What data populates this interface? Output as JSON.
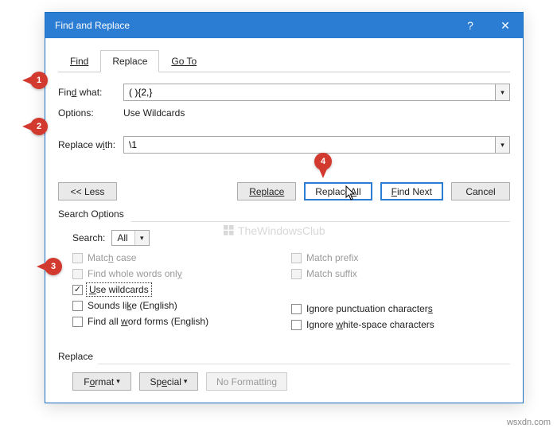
{
  "dialog": {
    "title": "Find and Replace",
    "help": "?",
    "close": "✕"
  },
  "tabs": {
    "find": "Find",
    "replace": "Replace",
    "goto": "Go To"
  },
  "find": {
    "label_pre": "Fin",
    "label_ul": "d",
    "label_post": " what:",
    "value": "( ){2,}",
    "options_label": "Options:",
    "options_value": "Use Wildcards"
  },
  "replace": {
    "label": "Replace w",
    "label_ul": "i",
    "label_post": "th:",
    "value": "\\1"
  },
  "buttons": {
    "less": "<< Less",
    "replace": "Replace",
    "replace_all_pre": "Replace ",
    "replace_all_ul": "A",
    "replace_all_post": "ll",
    "find_next_pre": "",
    "find_next_ul": "F",
    "find_next_post": "ind Next",
    "cancel": "Cancel"
  },
  "search_options": {
    "group": "Search Options",
    "search_label_ul": ":",
    "search_label": "Search",
    "search_value": "All",
    "match_case_pre": "Matc",
    "match_case_ul": "h",
    "match_case_post": " case",
    "whole_words_pre": "Find whole words onl",
    "whole_words_ul": "y",
    "use_wildcards_pre": "",
    "use_wildcards_ul": "U",
    "use_wildcards_post": "se wildcards",
    "sounds_like_pre": "Sounds li",
    "sounds_like_ul": "k",
    "sounds_like_post": "e (English)",
    "word_forms_pre": "Find all ",
    "word_forms_ul": "w",
    "word_forms_post": "ord forms (English)",
    "match_prefix": "Match prefix",
    "match_suffix": "Match suffix",
    "ignore_punct_pre": "Ignore punctuation character",
    "ignore_punct_ul": "s",
    "ignore_white_pre": "Ignore ",
    "ignore_white_ul": "w",
    "ignore_white_post": "hite-space characters"
  },
  "replace_group": {
    "label": "Replace",
    "format_pre": "F",
    "format_ul": "o",
    "format_post": "rmat",
    "special_pre": "Sp",
    "special_ul": "e",
    "special_post": "cial",
    "no_formatting": "No Formatting"
  },
  "callouts": {
    "c1": "1",
    "c2": "2",
    "c3": "3",
    "c4": "4"
  },
  "watermark": "TheWindowsClub",
  "footer": "wsxdn.com"
}
